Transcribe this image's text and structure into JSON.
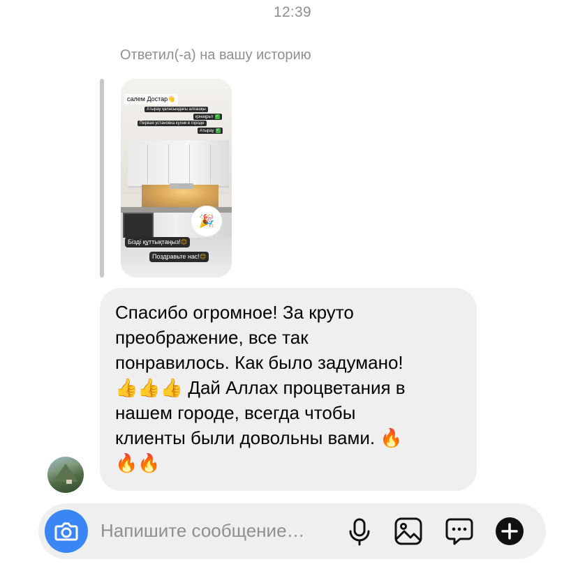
{
  "thread": {
    "timestamp": "12:39",
    "reply_note": "Ответил(-а) на вашу историю"
  },
  "story": {
    "greeting": "салем Достар",
    "greeting_emoji": "👋",
    "tags": [
      "Атырау қаласындағы алғашқы",
      "қонақрыт",
      "Первая установка кухни в городе",
      "Атырау"
    ],
    "bottom_kz": "Бізді құттықтаңыз!",
    "bottom_ru": "Поздравьте нас!",
    "sticker_emoji": "🎉",
    "smile_emoji": "😊",
    "check_glyph": "✓"
  },
  "message": {
    "text": "Спасибо огромное! За круто\nпреображение, все так\nпонравилось. Как было задумано!\n👍👍👍 Дай Аллах процветания в\nнашем городе, всегда чтобы\nклиенты были довольны вами. 🔥\n🔥🔥"
  },
  "composer": {
    "placeholder": "Напишите сообщение…",
    "icons": [
      "camera-icon",
      "microphone-icon",
      "gallery-icon",
      "sticker-icon",
      "plus-icon"
    ]
  },
  "colors": {
    "accent": "#3a86f4",
    "bubble": "#efeff0",
    "meta_text": "#8e8e93"
  }
}
